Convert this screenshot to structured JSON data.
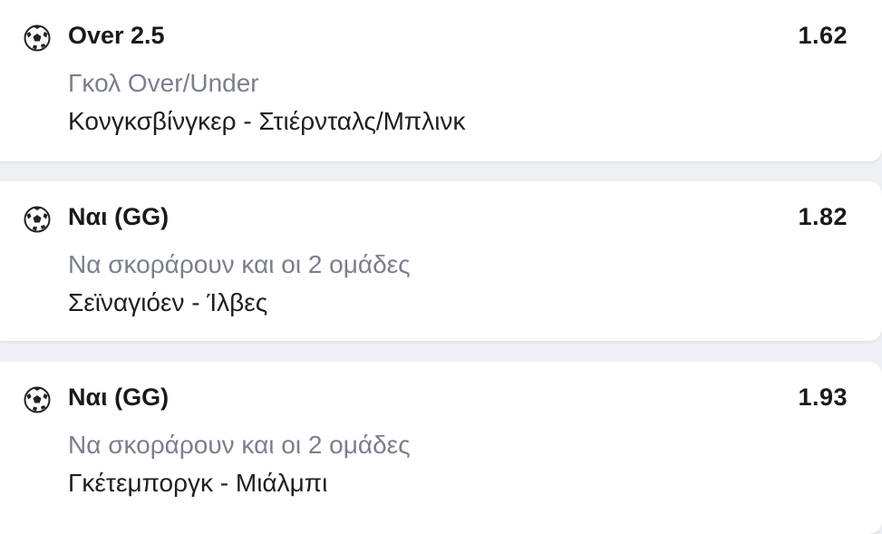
{
  "bets": [
    {
      "icon": "soccer-ball-icon",
      "selection": "Over 2.5",
      "odds": "1.62",
      "market": "Γκολ Over/Under",
      "match": "Κονγκσβίνγκερ - Στιέρνταλς/Μπλινκ"
    },
    {
      "icon": "soccer-ball-icon",
      "selection": "Ναι (GG)",
      "odds": "1.82",
      "market": "Να σκοράρουν και οι 2 ομάδες",
      "match": "Σεϊναγιόεν - Ίλβες"
    },
    {
      "icon": "soccer-ball-icon",
      "selection": "Ναι (GG)",
      "odds": "1.93",
      "market": "Να σκοράρουν και οι 2 ομάδες",
      "match": "Γκέτεμποργκ - Μιάλμπι"
    }
  ]
}
